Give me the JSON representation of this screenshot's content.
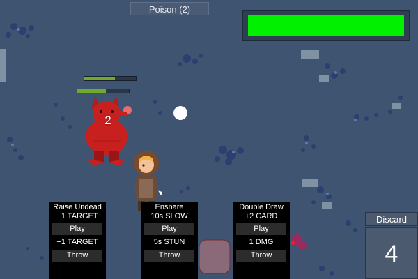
{
  "hud": {
    "status_effect_label": "Poison (2)",
    "boss_health_fraction": 1.0,
    "boss_health_color": "#00f000"
  },
  "enemy": {
    "name_icon": "red-demon-icon",
    "stack_count": "2",
    "bars": [
      {
        "fraction": 0.6
      },
      {
        "fraction": 0.55
      }
    ]
  },
  "player": {
    "icon": "hooded-hero-icon"
  },
  "hand": [
    {
      "title": "Raise Undead",
      "effect": "+1 TARGET",
      "play_label": "Play",
      "throw_effect": "+1 TARGET",
      "throw_label": "Throw"
    },
    {
      "title": "Ensnare",
      "effect": "10s SLOW",
      "play_label": "Play",
      "throw_effect": "5s STUN",
      "throw_label": "Throw"
    },
    {
      "title": "Double Draw",
      "effect": "+2 CARD",
      "play_label": "Play",
      "throw_effect": "1 DMG",
      "throw_label": "Throw"
    }
  ],
  "discard": {
    "label": "Discard",
    "count": "4"
  }
}
